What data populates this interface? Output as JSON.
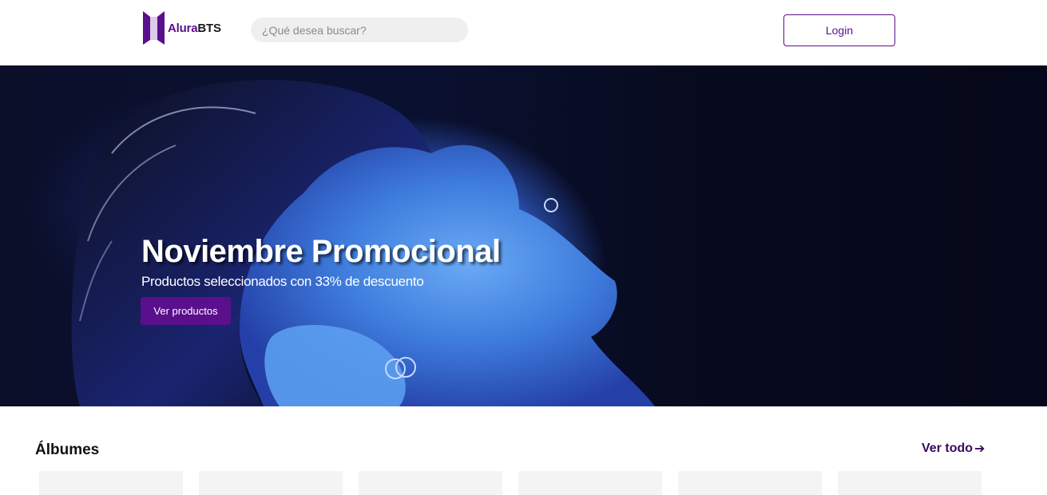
{
  "header": {
    "logo": {
      "brand": "Alura",
      "brand_accent": "BTS",
      "icon": "bts-logo-icon"
    },
    "search": {
      "placeholder": "¿Qué desea buscar?",
      "value": ""
    },
    "login_label": "Login"
  },
  "hero": {
    "title": "Noviembre Promocional",
    "subtitle": "Productos seleccionados con 33% de descuento",
    "button_label": "Ver productos"
  },
  "albums": {
    "title": "Álbumes",
    "see_all_label": "Ver todo",
    "see_all_icon": "arrow-right-icon",
    "cards": [
      "",
      "",
      "",
      "",
      "",
      ""
    ]
  },
  "colors": {
    "brand_purple": "#5a0f8c",
    "hero_dark": "#0b0f2a",
    "search_bg": "#efefef"
  }
}
